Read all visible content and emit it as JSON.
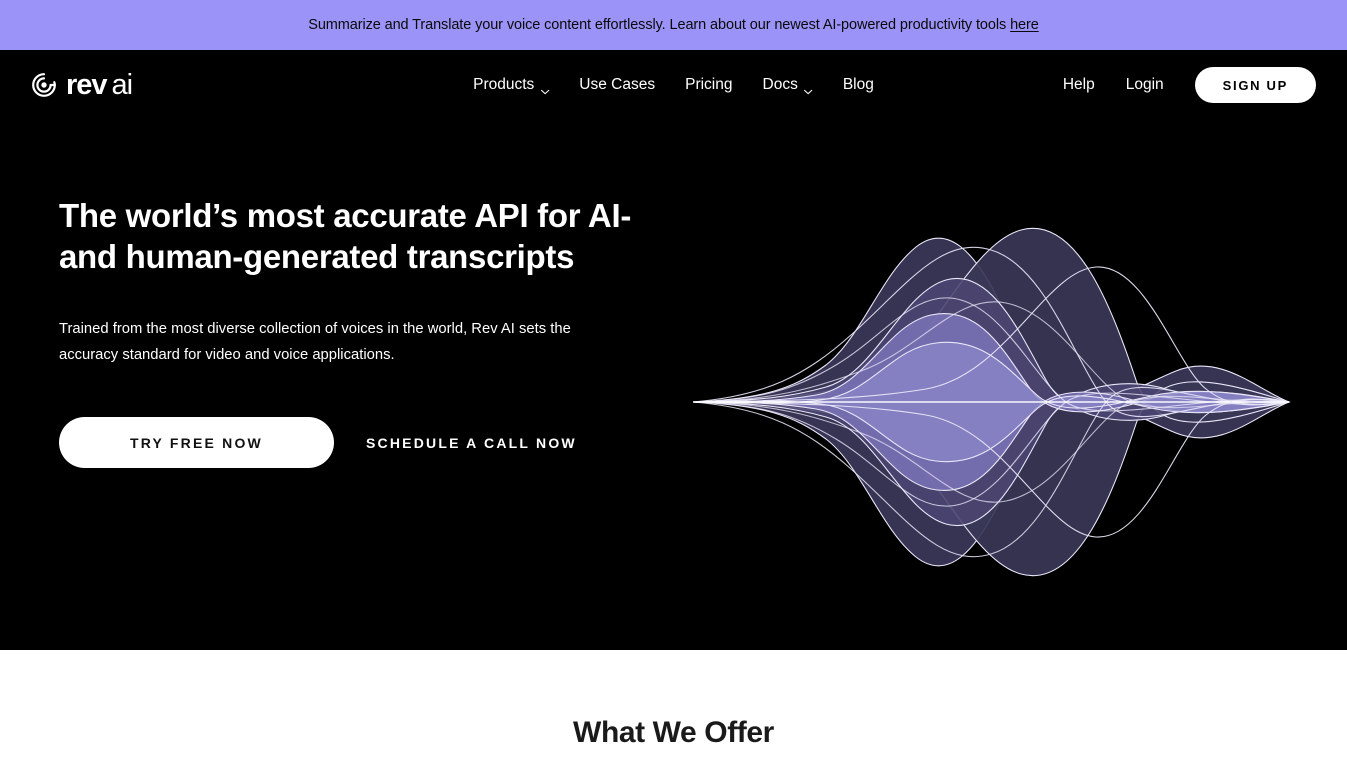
{
  "announcement": {
    "text": "Summarize and Translate your voice content effortlessly. Learn about our newest AI-powered productivity tools",
    "link_label": "here",
    "background_color": "#9b93f7"
  },
  "header": {
    "brand": {
      "icon": "rev-spiral-logo-icon",
      "name_bold": "rev",
      "name_light": "ai"
    },
    "nav": [
      {
        "label": "Products",
        "has_dropdown": true,
        "icon": "chevron-down-icon"
      },
      {
        "label": "Use Cases",
        "has_dropdown": false
      },
      {
        "label": "Pricing",
        "has_dropdown": false
      },
      {
        "label": "Docs",
        "has_dropdown": true,
        "icon": "chevron-down-icon"
      },
      {
        "label": "Blog",
        "has_dropdown": false
      }
    ],
    "help_label": "Help",
    "login_label": "Login",
    "signup_label": "SIGN UP"
  },
  "hero": {
    "title_line1": "The world’s most accurate API for AI-",
    "title_line2": "and human-generated transcripts",
    "subtitle": "Trained from the most diverse collection of voices in the world, Rev AI sets the accuracy standard for video and voice applications.",
    "primary_cta": "TRY FREE NOW",
    "secondary_cta": "SCHEDULE A CALL NOW",
    "background_color": "#000000",
    "illustration": {
      "name": "audio-waveform-illustration",
      "palette": [
        "#3a3757",
        "#4a4670",
        "#5b5589",
        "#6f68a8",
        "#8b85c4",
        "#ffffff"
      ]
    }
  },
  "offer_section": {
    "title": "What We Offer",
    "background_color": "#ffffff"
  }
}
